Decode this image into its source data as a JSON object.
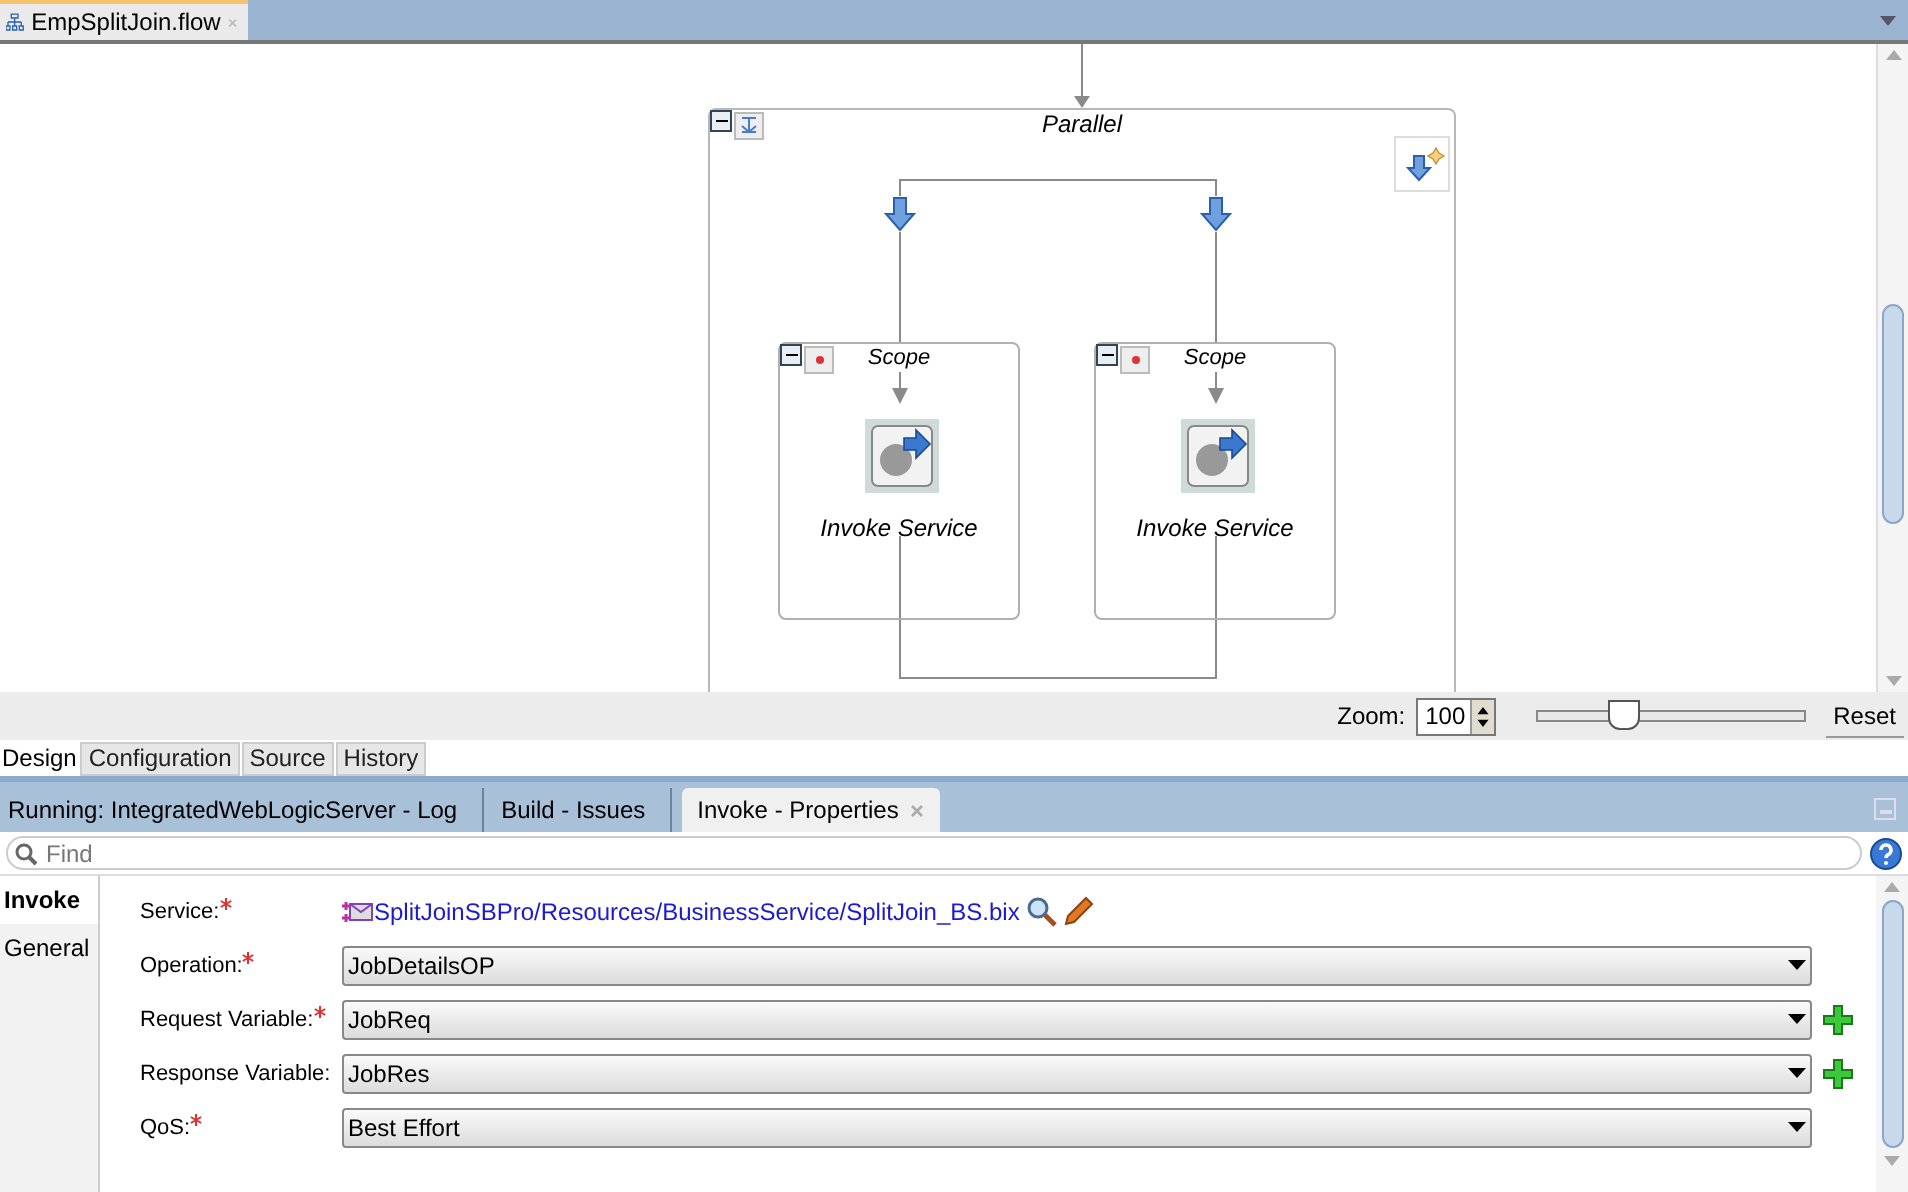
{
  "editor_tab": {
    "title": "EmpSplitJoin.flow"
  },
  "diagram": {
    "parallel": {
      "label": "Parallel"
    },
    "scopes": [
      {
        "label": "Scope",
        "node": "Invoke Service"
      },
      {
        "label": "Scope",
        "node": "Invoke Service"
      }
    ]
  },
  "zoom": {
    "label": "Zoom:",
    "value": "100",
    "level": 0.33,
    "reset": "Reset"
  },
  "view_tabs": [
    {
      "label": "Design",
      "selected": true
    },
    {
      "label": "Configuration",
      "selected": false
    },
    {
      "label": "Source",
      "selected": false
    },
    {
      "label": "History",
      "selected": false
    }
  ],
  "panel_tabs": [
    {
      "label": "Running: IntegratedWebLogicServer - Log",
      "selected": false
    },
    {
      "label": "Build - Issues",
      "selected": false
    },
    {
      "label": "Invoke - Properties",
      "selected": true
    }
  ],
  "find": {
    "placeholder": "Find"
  },
  "side_nav": {
    "title": "Invoke",
    "items": [
      {
        "label": "General"
      }
    ]
  },
  "fields": [
    {
      "label": "Service:",
      "required": true,
      "kind": "link",
      "value": "SplitJoinSBPro/Resources/BusinessService/SplitJoin_BS.bix"
    },
    {
      "label": "Operation:",
      "required": true,
      "kind": "select",
      "value": "JobDetailsOP",
      "addable": false
    },
    {
      "label": "Request Variable:",
      "required": true,
      "kind": "select",
      "value": "JobReq",
      "addable": true
    },
    {
      "label": "Response Variable:",
      "required": false,
      "kind": "select",
      "value": "JobRes",
      "addable": true
    },
    {
      "label": "QoS:",
      "required": true,
      "kind": "select",
      "value": "Best Effort",
      "addable": false
    }
  ]
}
